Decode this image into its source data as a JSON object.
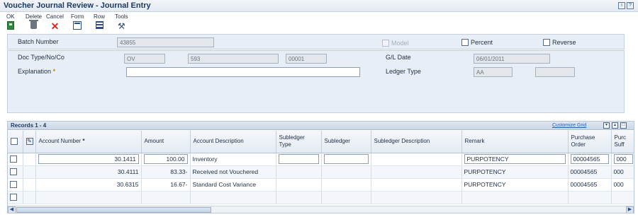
{
  "window": {
    "title": "Voucher Journal Review - Journal Entry",
    "header_icons": [
      "info-icon",
      "help-icon"
    ]
  },
  "toolbar": {
    "ok": {
      "label": "OK",
      "icon": "save-icon"
    },
    "delete": {
      "label": "Delete",
      "icon": "trash-icon"
    },
    "cancel": {
      "label": "Cancel",
      "icon": "cancel-x-icon"
    },
    "form": {
      "label": "Form",
      "icon": "form-icon"
    },
    "row": {
      "label": "Row",
      "icon": "row-icon"
    },
    "tools": {
      "label": "Tools",
      "icon": "tools-icon"
    }
  },
  "header": {
    "batch_number_label": "Batch Number",
    "batch_number": "43855",
    "model_label": "Model",
    "percent_label": "Percent",
    "reverse_label": "Reverse",
    "doc_label": "Doc Type/No/Co",
    "doc_type": "OV",
    "doc_number": "593",
    "doc_company": "00001",
    "gl_date_label": "G/L Date",
    "gl_date": "06/01/2011",
    "explanation_label": "Explanation",
    "required_marker": "*",
    "explanation": "",
    "ledger_type_label": "Ledger Type",
    "ledger_type": "AA",
    "ledger_type_extra": ""
  },
  "grid": {
    "records_label": "Records 1 - 4",
    "customize_label": "Customize Grid",
    "columns": [
      "",
      "",
      "Account Number",
      "Amount",
      "Account Description",
      "Subledger Type",
      "Subledger",
      "Subledger Description",
      "Remark",
      "Purchase Order",
      "Purc Suff"
    ],
    "account_required_marker": "*",
    "rows": [
      {
        "account": "30.1411",
        "amount": "100.00",
        "description": "Inventory",
        "subledger_type": "",
        "subledger": "",
        "subledger_desc": "",
        "remark": "PURPOTENCY",
        "po": "00004565",
        "suffix": "000"
      },
      {
        "account": "30.4111",
        "amount": "83.33-",
        "description": "Received not Vouchered",
        "subledger_type": "",
        "subledger": "",
        "subledger_desc": "",
        "remark": "PURPOTENCY",
        "po": "00004565",
        "suffix": "000"
      },
      {
        "account": "30.6315",
        "amount": "16.67-",
        "description": "Standard Cost Variance",
        "subledger_type": "",
        "subledger": "",
        "subledger_desc": "",
        "remark": "PURPOTENCY",
        "po": "00004565",
        "suffix": "000"
      },
      {
        "account": "",
        "amount": "",
        "description": "",
        "subledger_type": "",
        "subledger": "",
        "subledger_desc": "",
        "remark": "",
        "po": "",
        "suffix": ""
      }
    ]
  },
  "colors": {
    "title": "#1d3b62",
    "panel_bg": "#e8eef5",
    "required": "#d98000",
    "link": "#2a5db0"
  }
}
